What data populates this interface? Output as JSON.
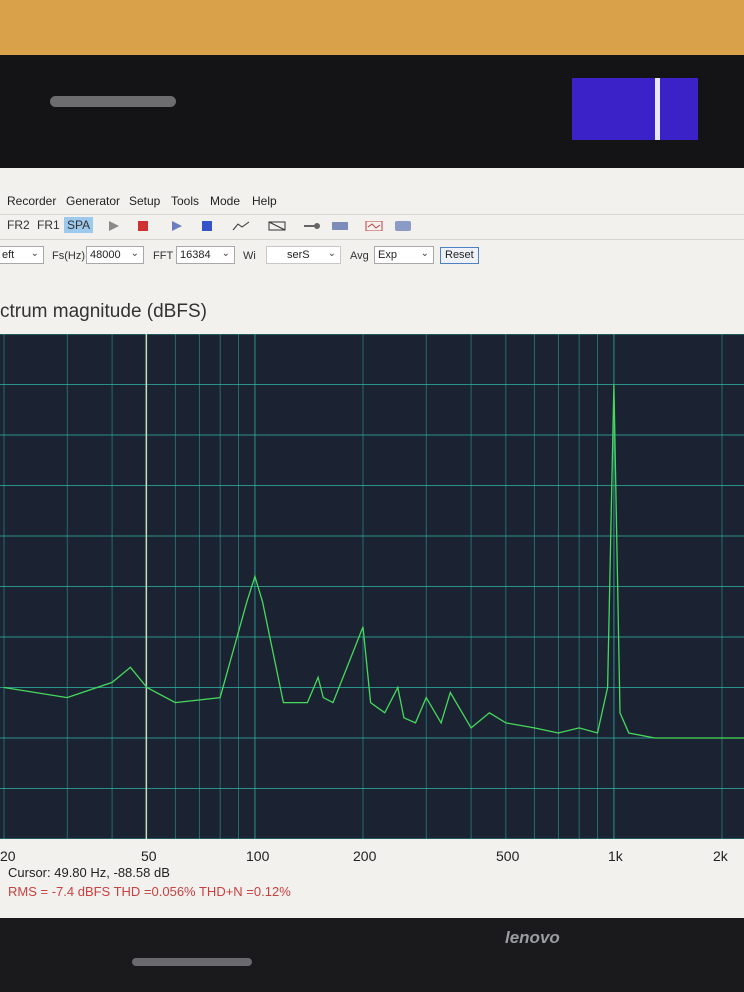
{
  "menu": {
    "items": [
      "Recorder",
      "Generator",
      "Setup",
      "Tools",
      "Mode",
      "Help"
    ]
  },
  "toolbar": {
    "tabs": [
      "FR2",
      "FR1",
      "SPA"
    ],
    "active_tab": "SPA",
    "icons": [
      "play-icon",
      "record-icon",
      "play-icon",
      "stop-icon",
      "chart-icon",
      "grid-icon",
      "probe-icon",
      "meter-icon",
      "scope-icon",
      "panel-icon"
    ]
  },
  "settings": {
    "channel_value": "eft",
    "fs_label": "Fs(Hz)",
    "fs_value": "48000",
    "fft_label": "FFT",
    "fft_value": "16384",
    "window_label": "Wi",
    "window_value": "serS",
    "avg_label": "Avg",
    "avg_value": "Exp",
    "reset_label": "Reset"
  },
  "graph": {
    "title": "ctrum magnitude (dBFS)",
    "x_ticks": [
      "20",
      "50",
      "100",
      "200",
      "500",
      "1k",
      "2k"
    ],
    "cursor_text": "Cursor: 49.80 Hz, -88.58 dB",
    "stats_text": "RMS =   -7.4 dBFS  THD =0.056%  THD+N =0.12%"
  },
  "device": {
    "brand": "lenovo"
  },
  "colors": {
    "plot_background": "#1b2333",
    "grid_color": "#2fb6a6",
    "trace_color": "#46d95a",
    "cursor_color": "#e8eec0",
    "stats_color": "#c94141",
    "sticker_color": "#3b22c8"
  },
  "chart_data": {
    "type": "line",
    "title": "ctrum magnitude (dBFS)",
    "xlabel": "",
    "ylabel": "",
    "x_scale": "log",
    "x_tick_labels": [
      "20",
      "50",
      "100",
      "200",
      "500",
      "1k",
      "2k"
    ],
    "cursor": {
      "x": 49.8,
      "y": -88.58
    },
    "series": [
      {
        "x": [
          20,
          30,
          40,
          45,
          50,
          60,
          80,
          95,
          100,
          105,
          120,
          140,
          150,
          155,
          165,
          190,
          200,
          210,
          230,
          250,
          260,
          280,
          300,
          330,
          350,
          400,
          450,
          500,
          600,
          700,
          800,
          900,
          960,
          1000,
          1040,
          1100,
          1300,
          1600,
          2000,
          2500
        ],
        "y": [
          -90,
          -92,
          -89,
          -86,
          -90,
          -93,
          -92,
          -73,
          -68,
          -73,
          -93,
          -93,
          -88,
          -92,
          -93,
          -82,
          -78,
          -93,
          -95,
          -90,
          -96,
          -97,
          -92,
          -97,
          -91,
          -98,
          -95,
          -97,
          -98,
          -99,
          -98,
          -99,
          -90,
          -30,
          -95,
          -99,
          -100,
          -100,
          -100,
          -100
        ]
      }
    ]
  }
}
